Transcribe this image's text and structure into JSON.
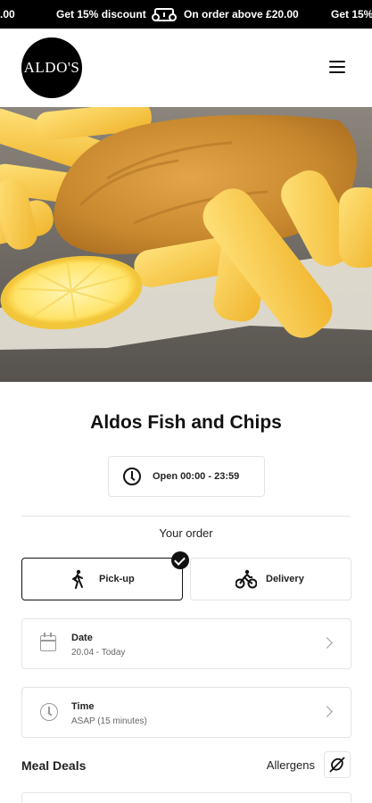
{
  "promo": {
    "left_fragment": ".00",
    "discount": "Get 15% discount",
    "condition": "On order above £20.00",
    "discount_repeat": "Get 15%",
    "icon": "ticket-icon"
  },
  "header": {
    "logo_text": "ALDO'S",
    "menu_icon": "hamburger-menu-icon"
  },
  "hero": {
    "alt": "fish-and-chips-image"
  },
  "restaurant": {
    "name": "Aldos Fish and Chips",
    "hours": "Open 00:00 - 23:59"
  },
  "order": {
    "heading": "Your order",
    "pickup_label": "Pick-up",
    "delivery_label": "Delivery",
    "selected": "Pick-up",
    "date_label": "Date",
    "date_value": "20.04 - Today",
    "time_label": "Time",
    "time_value": "ASAP (15 minutes)"
  },
  "menu": {
    "section_title": "Meal Deals",
    "allergens_label": "Allergens"
  }
}
